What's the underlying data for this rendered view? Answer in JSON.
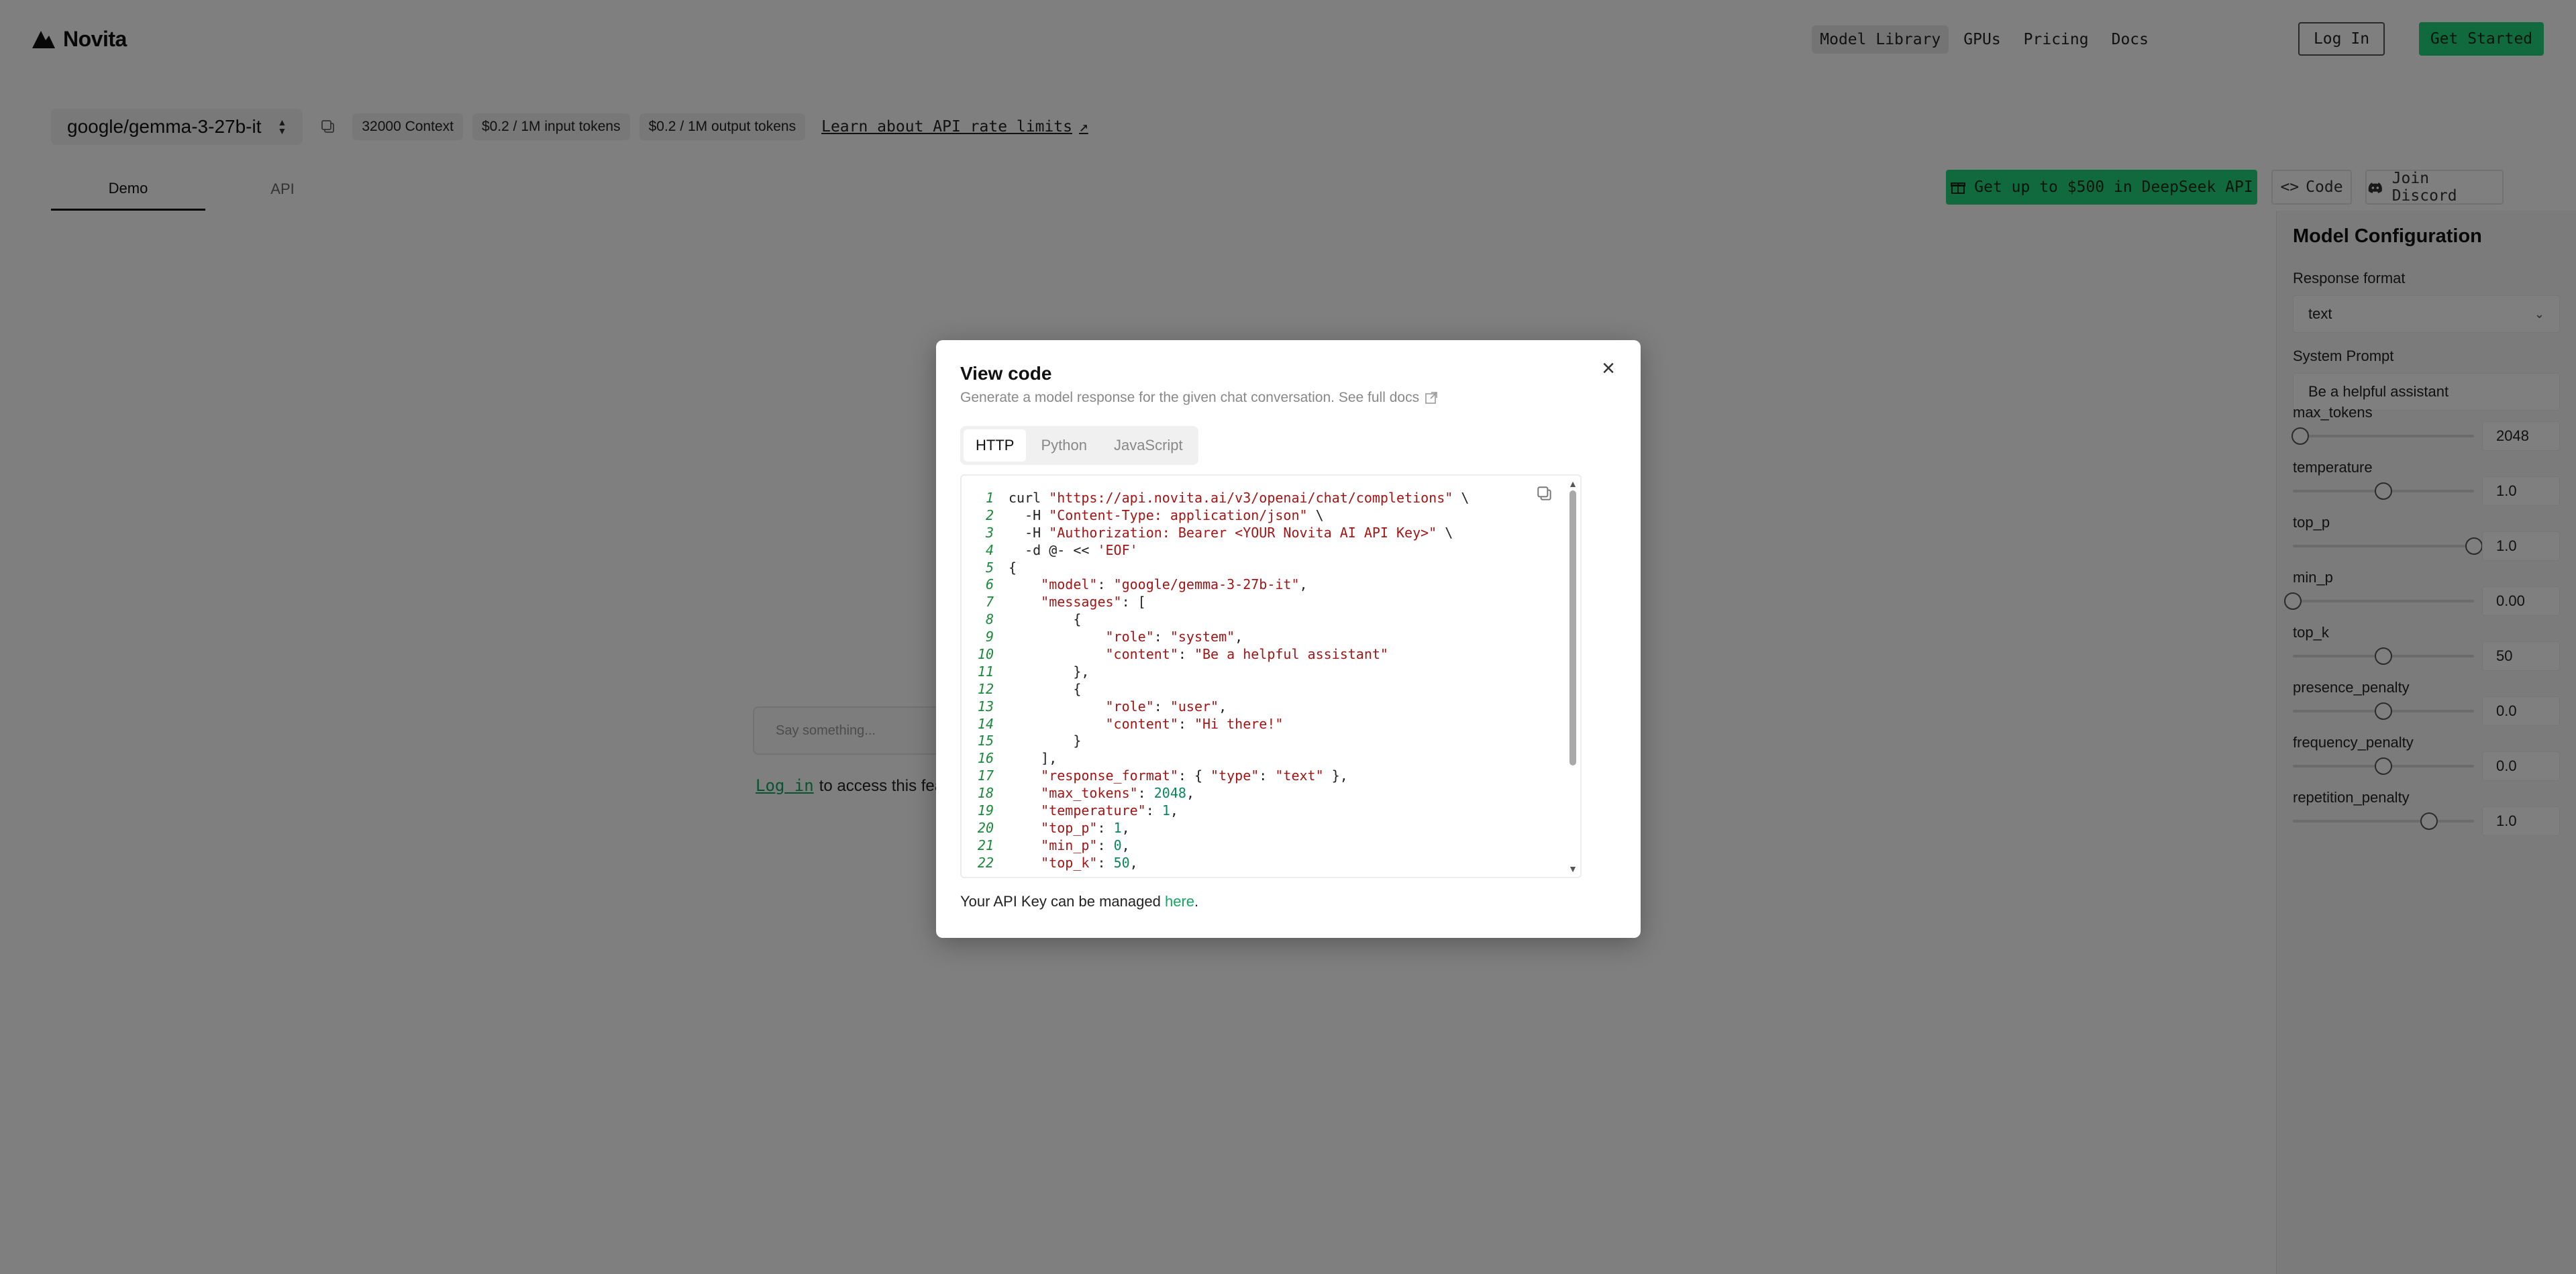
{
  "nav": {
    "logo": "Novita",
    "links": [
      "Model Library",
      "GPUs",
      "Pricing",
      "Docs"
    ],
    "login": "Log In",
    "get_started": "Get Started"
  },
  "model_bar": {
    "model": "google/gemma-3-27b-it",
    "chips": [
      "32000 Context",
      "$0.2 / 1M input tokens",
      "$0.2 / 1M output tokens"
    ],
    "rate_link": "Learn about API rate limits",
    "rate_arrow": "↗"
  },
  "tabs": {
    "demo": "Demo",
    "api": "API"
  },
  "actions": {
    "deal": "Get up to $500 in DeepSeek API",
    "code": "Code",
    "discord": "Join Discord"
  },
  "chat": {
    "placeholder": "Say something...",
    "login_link": "Log in",
    "login_text": "to access this feature"
  },
  "config": {
    "title": "Model Configuration",
    "response_format_label": "Response format",
    "response_format_value": "text",
    "system_prompt_label": "System Prompt",
    "system_prompt_value": "Be a helpful assistant",
    "sliders": [
      {
        "label": "max_tokens",
        "value": "2048",
        "fill": 0.04
      },
      {
        "label": "temperature",
        "value": "1.0",
        "fill": 0.5
      },
      {
        "label": "top_p",
        "value": "1.0",
        "fill": 1.0
      },
      {
        "label": "min_p",
        "value": "0.00",
        "fill": 0.0
      },
      {
        "label": "top_k",
        "value": "50",
        "fill": 0.5
      },
      {
        "label": "presence_penalty",
        "value": "0.0",
        "fill": 0.5
      },
      {
        "label": "frequency_penalty",
        "value": "0.0",
        "fill": 0.5
      },
      {
        "label": "repetition_penalty",
        "value": "1.0",
        "fill": 0.75
      }
    ]
  },
  "modal": {
    "title": "View code",
    "subtitle": "Generate a model response for the given chat conversation. See full docs",
    "tabs": [
      "HTTP",
      "Python",
      "JavaScript"
    ],
    "active_tab": "HTTP",
    "footer_text": "Your API Key can be managed",
    "footer_link": "here",
    "footer_end": ".",
    "code": [
      [
        [
          "t",
          "curl "
        ],
        [
          "s",
          "\"https://api.novita.ai/v3/openai/chat/completions\""
        ],
        [
          "t",
          " \\"
        ]
      ],
      [
        [
          "t",
          "  -H "
        ],
        [
          "s",
          "\"Content-Type: application/json\""
        ],
        [
          "t",
          " \\"
        ]
      ],
      [
        [
          "t",
          "  -H "
        ],
        [
          "s",
          "\"Authorization: Bearer <YOUR Novita AI API Key>\""
        ],
        [
          "t",
          " \\"
        ]
      ],
      [
        [
          "t",
          "  -d @- << "
        ],
        [
          "s",
          "'EOF'"
        ]
      ],
      [
        [
          "t",
          "{"
        ]
      ],
      [
        [
          "t",
          "    "
        ],
        [
          "s",
          "\"model\""
        ],
        [
          "t",
          ": "
        ],
        [
          "s",
          "\"google/gemma-3-27b-it\""
        ],
        [
          "t",
          ","
        ]
      ],
      [
        [
          "t",
          "    "
        ],
        [
          "s",
          "\"messages\""
        ],
        [
          "t",
          ": ["
        ]
      ],
      [
        [
          "t",
          "        {"
        ]
      ],
      [
        [
          "t",
          "            "
        ],
        [
          "s",
          "\"role\""
        ],
        [
          "t",
          ": "
        ],
        [
          "s",
          "\"system\""
        ],
        [
          "t",
          ","
        ]
      ],
      [
        [
          "t",
          "            "
        ],
        [
          "s",
          "\"content\""
        ],
        [
          "t",
          ": "
        ],
        [
          "s",
          "\"Be a helpful assistant\""
        ]
      ],
      [
        [
          "t",
          "        },"
        ]
      ],
      [
        [
          "t",
          "        {"
        ]
      ],
      [
        [
          "t",
          "            "
        ],
        [
          "s",
          "\"role\""
        ],
        [
          "t",
          ": "
        ],
        [
          "s",
          "\"user\""
        ],
        [
          "t",
          ","
        ]
      ],
      [
        [
          "t",
          "            "
        ],
        [
          "s",
          "\"content\""
        ],
        [
          "t",
          ": "
        ],
        [
          "s",
          "\"Hi there!\""
        ]
      ],
      [
        [
          "t",
          "        }"
        ]
      ],
      [
        [
          "t",
          "    ],"
        ]
      ],
      [
        [
          "t",
          "    "
        ],
        [
          "s",
          "\"response_format\""
        ],
        [
          "t",
          ": { "
        ],
        [
          "s",
          "\"type\""
        ],
        [
          "t",
          ": "
        ],
        [
          "s",
          "\"text\""
        ],
        [
          "t",
          " },"
        ]
      ],
      [
        [
          "t",
          "    "
        ],
        [
          "s",
          "\"max_tokens\""
        ],
        [
          "t",
          ": "
        ],
        [
          "n",
          "2048"
        ],
        [
          "t",
          ","
        ]
      ],
      [
        [
          "t",
          "    "
        ],
        [
          "s",
          "\"temperature\""
        ],
        [
          "t",
          ": "
        ],
        [
          "n",
          "1"
        ],
        [
          "t",
          ","
        ]
      ],
      [
        [
          "t",
          "    "
        ],
        [
          "s",
          "\"top_p\""
        ],
        [
          "t",
          ": "
        ],
        [
          "n",
          "1"
        ],
        [
          "t",
          ","
        ]
      ],
      [
        [
          "t",
          "    "
        ],
        [
          "s",
          "\"min_p\""
        ],
        [
          "t",
          ": "
        ],
        [
          "n",
          "0"
        ],
        [
          "t",
          ","
        ]
      ],
      [
        [
          "t",
          "    "
        ],
        [
          "s",
          "\"top_k\""
        ],
        [
          "t",
          ": "
        ],
        [
          "n",
          "50"
        ],
        [
          "t",
          ","
        ]
      ]
    ]
  },
  "colors": {
    "accent": "#23d57c",
    "link": "#16a565",
    "string": "#a31515",
    "number": "#098658",
    "line_number": "#1a8a3a"
  }
}
